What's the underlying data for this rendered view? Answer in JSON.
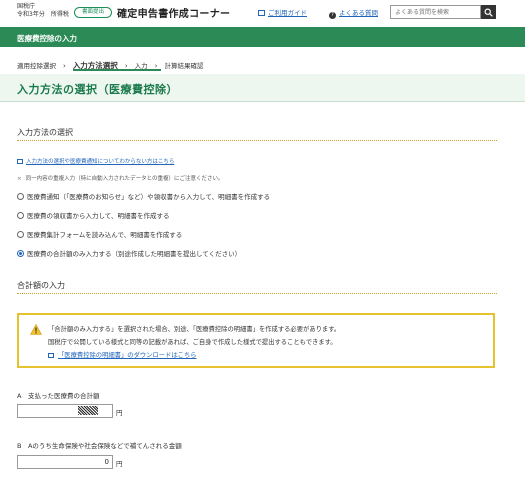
{
  "header": {
    "agency_line1": "国税庁",
    "agency_line2": "令和3年分　所得税",
    "badge": "書面提出",
    "site_title": "確定申告書作成コーナー",
    "guide_link": "ご利用ガイド",
    "faq_link": "よくある質問",
    "search_placeholder": "よくある質問を検索"
  },
  "greenbar": {
    "title": "医療費控除の入力"
  },
  "breadcrumb": {
    "items": [
      "適用控除選択",
      "入力方法選択",
      "入力",
      "計算結果確認"
    ],
    "current_index": 1
  },
  "page": {
    "title": "入力方法の選択（医療費控除）"
  },
  "method_section": {
    "title": "入力方法の選択",
    "help_link": "入力方法の選択や医療費通知についてわからない方はこちら",
    "note": "同一内容の重複入力（特に自動入力されたデータとの重複）にご注意ください。",
    "options": [
      "医療費通知（「医療費のお知らせ」など）や領収書から入力して、明細書を作成する",
      "医療費の領収書から入力して、明細書を作成する",
      "医療費集計フォームを読み込んで、明細書を作成する",
      "医療費の合計額のみ入力する（別途作成した明細書を提出してください）"
    ],
    "selected_index": 3
  },
  "total_section": {
    "title": "合計額の入力",
    "warning_line1": "「合計額のみ入力する」を選択された場合、別途、「医療費控除の明細書」を作成する必要があります。",
    "warning_line2": "国税庁で公開している様式と同等の記載があれば、ご自身で作成した様式で提出することもできます。",
    "warning_link": "「医療費控除の明細書」のダウンロードはこちら",
    "field_a_label": "A　支払った医療費の合計額",
    "field_a_value": "",
    "field_b_label": "B　Aのうち生命保険や社会保険などで補てんされる金額",
    "field_b_value": "0",
    "unit": "円"
  },
  "colors": {
    "brand_green": "#2b8a55",
    "link_blue": "#2266bb",
    "warning_yellow": "#e6c22e"
  }
}
